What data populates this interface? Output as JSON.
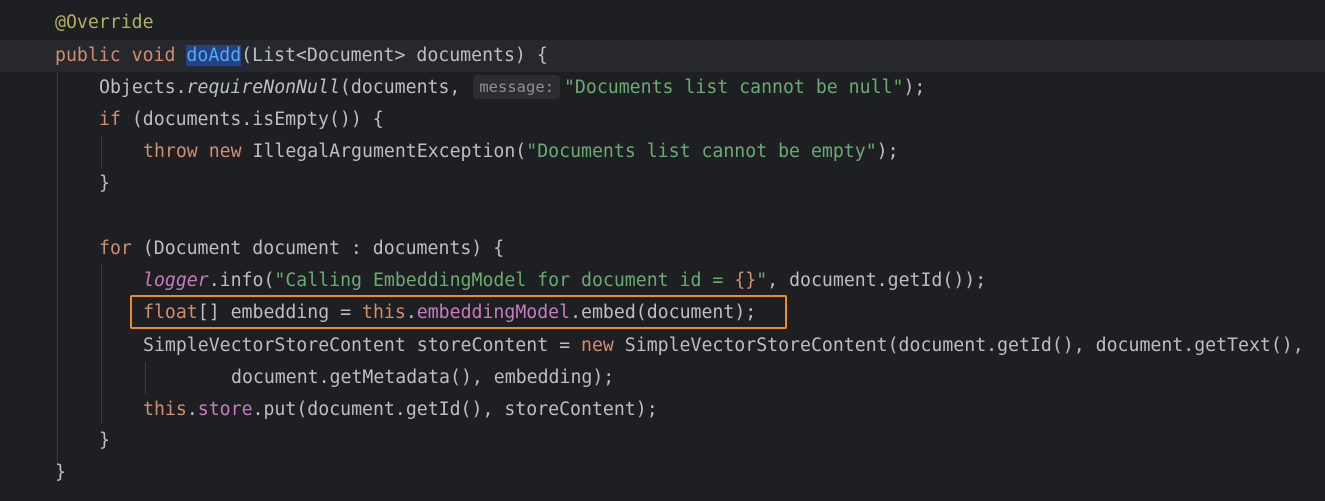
{
  "editor": {
    "annotation": "@Override",
    "method_signature": {
      "kw_public": "public",
      "kw_void": "void",
      "method_name": "doAdd",
      "params": "(List<Document> documents) {"
    },
    "line_require": {
      "obj": "Objects.",
      "method": "requireNonNull",
      "arg1": "(documents, ",
      "hint": "message:",
      "arg2": "\"Documents list cannot be null\"",
      "end": ");"
    },
    "line_if": {
      "kw": "if",
      "rest": " (documents.isEmpty()) {"
    },
    "line_throw": {
      "kw_throw": "throw",
      "kw_new": "new",
      "cls": " IllegalArgumentException(",
      "str": "\"Documents list cannot be empty\"",
      "end": ");"
    },
    "close_if": "}",
    "line_for": {
      "kw": "for",
      "rest": " (Document document : documents) {"
    },
    "line_logger": {
      "field": "logger",
      "call": ".info(",
      "str_a": "\"Calling EmbeddingModel for document id = ",
      "braces": "{}",
      "str_b": "\"",
      "rest": ", document.getId());"
    },
    "line_embed": {
      "kw_float": "float",
      "decl": "[] embedding = ",
      "kw_this": "this",
      "dot": ".",
      "field": "embeddingModel",
      "rest": ".embed(document);"
    },
    "line_store_content": {
      "decl": "SimpleVectorStoreContent storeContent = ",
      "kw_new": "new",
      "rest": " SimpleVectorStoreContent(document.getId(), document.getText(),"
    },
    "line_store_content_cont": "document.getMetadata(), embedding);",
    "line_put": {
      "kw_this": "this",
      "dot": ".",
      "field": "store",
      "rest": ".put(document.getId(), storeContent);"
    },
    "close_for": "}",
    "close_method": "}"
  }
}
